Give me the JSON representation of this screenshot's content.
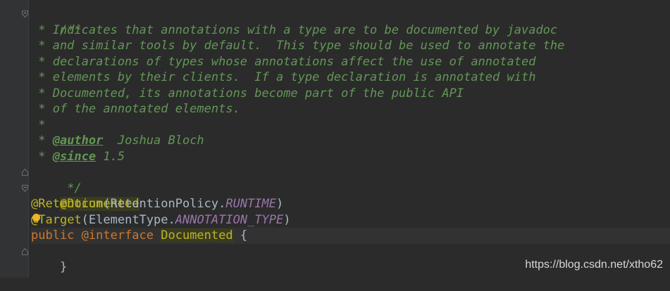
{
  "code": {
    "doc_open": "/**",
    "doc_lines": [
      " * Indicates that annotations with a type are to be documented by javadoc",
      " * and similar tools by default.  This type should be used to annotate the",
      " * declarations of types whose annotations affect the use of annotated",
      " * elements by their clients.  If a type declaration is annotated with",
      " * Documented, its annotations become part of the public API",
      " * of the annotated elements.",
      " *"
    ],
    "author_prefix": " * ",
    "author_tag": "@author",
    "author_value": "  Joshua Bloch",
    "since_prefix": " * ",
    "since_tag": "@since",
    "since_value": " 1.5",
    "doc_close": " */",
    "ann_documented": "@Documented",
    "ann_retention": "@Retention",
    "retention_open": "(RetentionPolicy.",
    "retention_const": "RUNTIME",
    "retention_close": ")",
    "ann_target_at": "@",
    "ann_target_rest": "Target",
    "target_open": "(ElementType.",
    "target_const": "ANNOTATION_TYPE",
    "target_close": ")",
    "kw_public": "public",
    "kw_interface": " @interface ",
    "type_name": "Documented",
    "brace_open": " {",
    "brace_close": "}"
  },
  "watermark": "https://blog.csdn.net/xtho62",
  "colors": {
    "background": "#2b2b2b",
    "doc_comment": "#629755",
    "annotation": "#bbb529",
    "keyword": "#cc7832",
    "constant": "#9876aa",
    "text": "#a9b7c6"
  }
}
